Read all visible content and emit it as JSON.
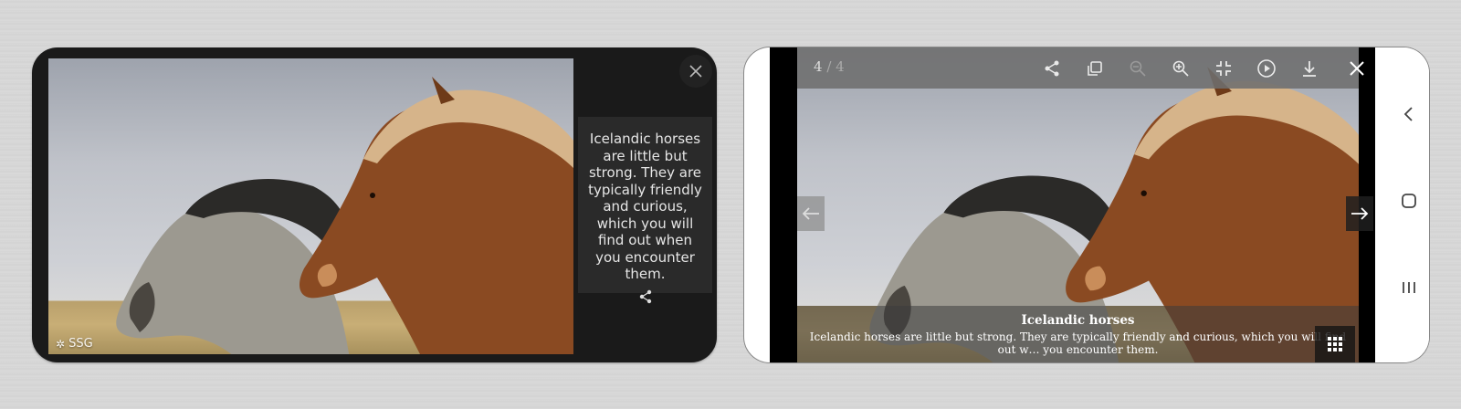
{
  "left_screen": {
    "watermark": "SSG",
    "caption": "Icelandic horses are little but strong. They are typically friendly and curious, which you will find out when you encounter them."
  },
  "right_screen": {
    "counter": {
      "current": "4",
      "separator": "/",
      "total": "4"
    },
    "toolbar_icons": [
      "share-icon",
      "copy-icon",
      "zoom-out-icon",
      "zoom-in-icon",
      "exit-fullscreen-icon",
      "play-icon",
      "download-icon",
      "close-icon"
    ],
    "caption_title": "Icelandic horses",
    "caption_text": "Icelandic horses are little but strong. They are typically friendly and curious, which you will find out w… you encounter them.",
    "android_nav": [
      "back-icon",
      "home-icon",
      "recents-icon"
    ]
  },
  "colors": {
    "left_bg": "#1a1a1a",
    "caption_card": "#2a2a2a",
    "topbar": "#6e6e6e",
    "viewer_bg": "#000000"
  }
}
